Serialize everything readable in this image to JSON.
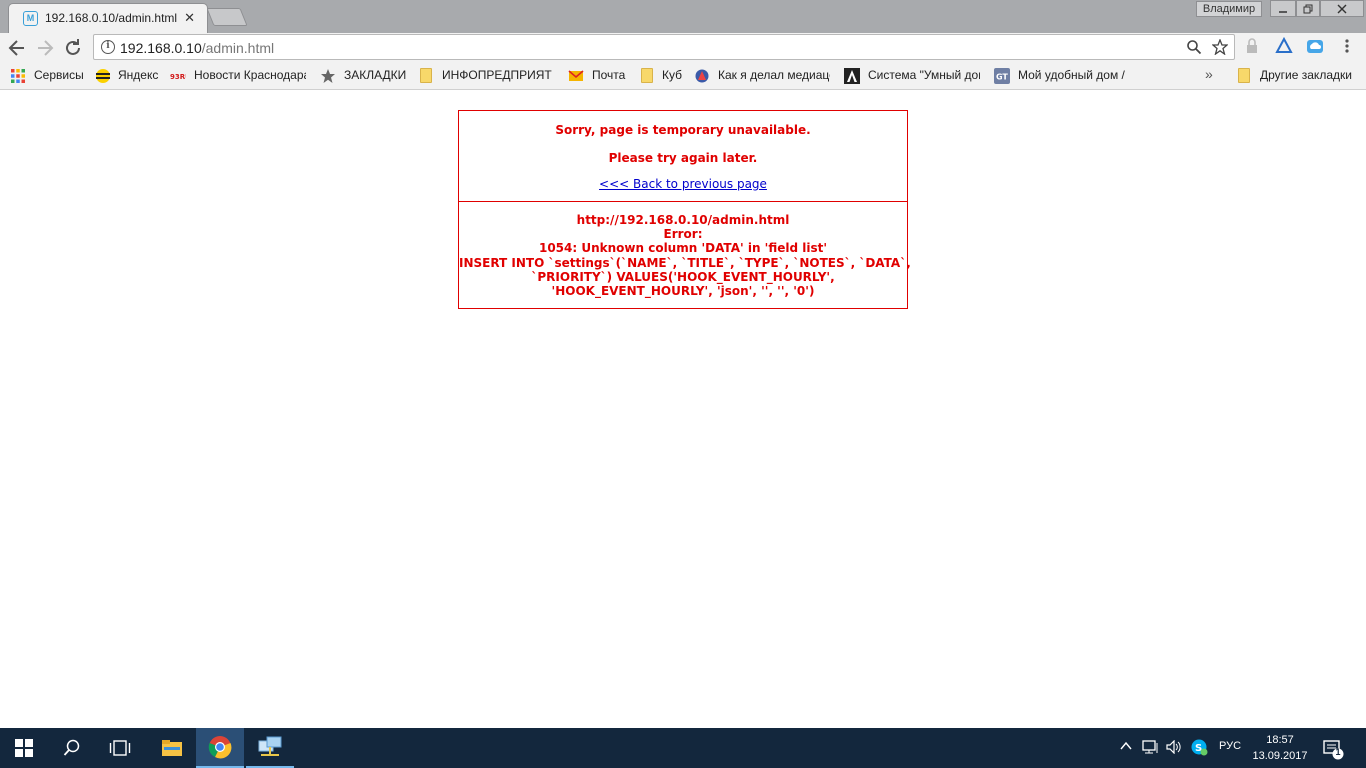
{
  "browser": {
    "tab_title": "192.168.0.10/admin.html",
    "tab_favicon_letter": "M",
    "profile_name": "Владимир",
    "url_host": "192.168.0.10",
    "url_path": "/admin.html"
  },
  "bookmarks": [
    {
      "label": "Сервисы",
      "icon": "apps-grid-icon"
    },
    {
      "label": "Яндекс",
      "icon": "beeline-icon"
    },
    {
      "label": "Новости Краснодара",
      "icon": "news-logo-icon"
    },
    {
      "label": "ЗАКЛАДКИ",
      "icon": "star-icon"
    },
    {
      "label": "ИНФОПРЕДПРИЯТИЕ",
      "icon": "folder-icon"
    },
    {
      "label": "Почта",
      "icon": "mail-icon"
    },
    {
      "label": "Куб",
      "icon": "folder-icon"
    },
    {
      "label": "Как я делал медиаце",
      "icon": "site-icon"
    },
    {
      "label": "Система \"Умный дом\"",
      "icon": "letter-a-icon"
    },
    {
      "label": "Мой удобный дом /",
      "icon": "gt-icon"
    }
  ],
  "bookmarks_overflow": "»",
  "other_bookmarks": "Другие закладки",
  "page": {
    "line1": "Sorry, page is temporary unavailable.",
    "line2": "Please try again later.",
    "back_link": "<<< Back to previous page",
    "error_url": "http://192.168.0.10/admin.html",
    "error_label": "Error:",
    "error_code": "1054: Unknown column 'DATA' in 'field list'",
    "sql_line1": "INSERT INTO `settings`(`NAME`, `TITLE`, `TYPE`, `NOTES`, `DATA`,",
    "sql_line2": "`PRIORITY`) VALUES('HOOK_EVENT_HOURLY',",
    "sql_line3": "'HOOK_EVENT_HOURLY', 'json', '', '', '0')"
  },
  "taskbar": {
    "language": "РУС",
    "time": "18:57",
    "date": "13.09.2017",
    "notification_count": "1"
  },
  "colors": {
    "error_red": "#e00000",
    "link_blue": "#0000cc",
    "taskbar": "#13273d"
  }
}
